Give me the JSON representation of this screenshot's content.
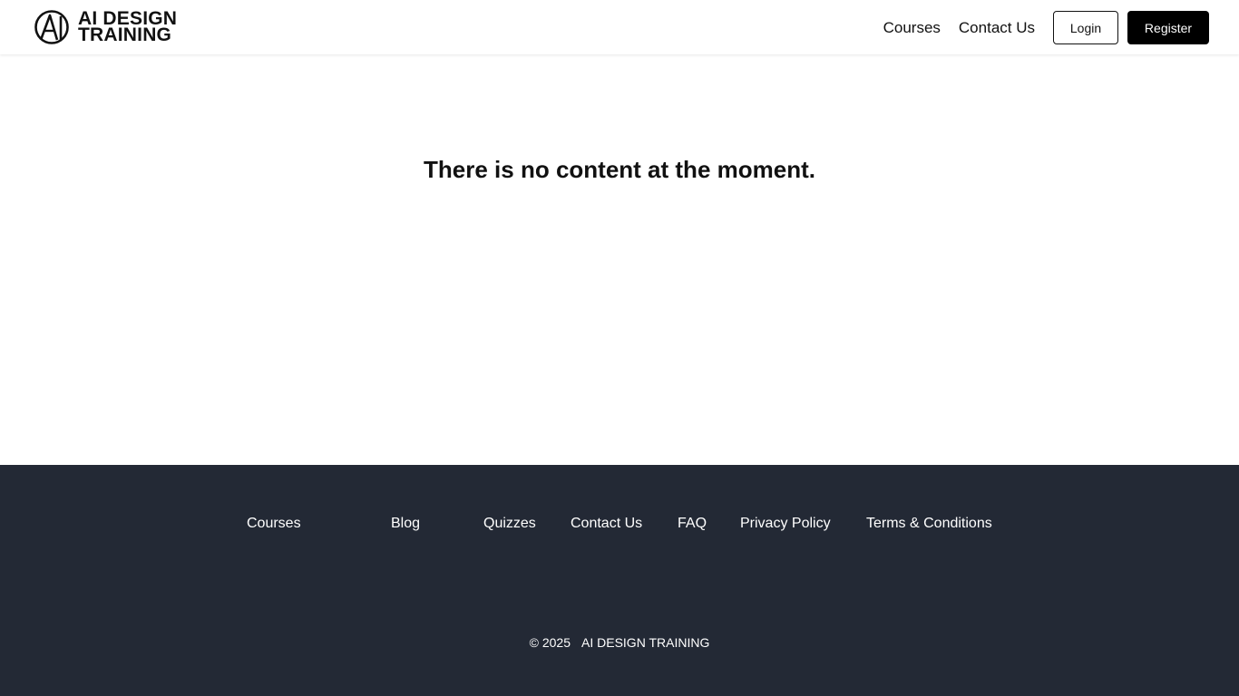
{
  "header": {
    "logo_line1": "AI DESIGN",
    "logo_line2": "TRAINING",
    "logo_icon": "ai-monogram-icon",
    "nav": [
      {
        "label": "Courses"
      },
      {
        "label": "Contact Us"
      }
    ],
    "login_label": "Login",
    "register_label": "Register"
  },
  "main": {
    "empty_message": "There is no content at the moment."
  },
  "footer": {
    "links": [
      {
        "label": "Courses"
      },
      {
        "label": "Blog"
      },
      {
        "label": "Quizzes"
      },
      {
        "label": "Contact Us"
      },
      {
        "label": "FAQ"
      },
      {
        "label": "Privacy Policy"
      },
      {
        "label": "Terms & Conditions"
      }
    ],
    "copyright_year": "© 2025",
    "copyright_name": "AI DESIGN TRAINING"
  },
  "colors": {
    "footer_bg": "#232935",
    "primary_button": "#000000",
    "text": "#111111"
  }
}
